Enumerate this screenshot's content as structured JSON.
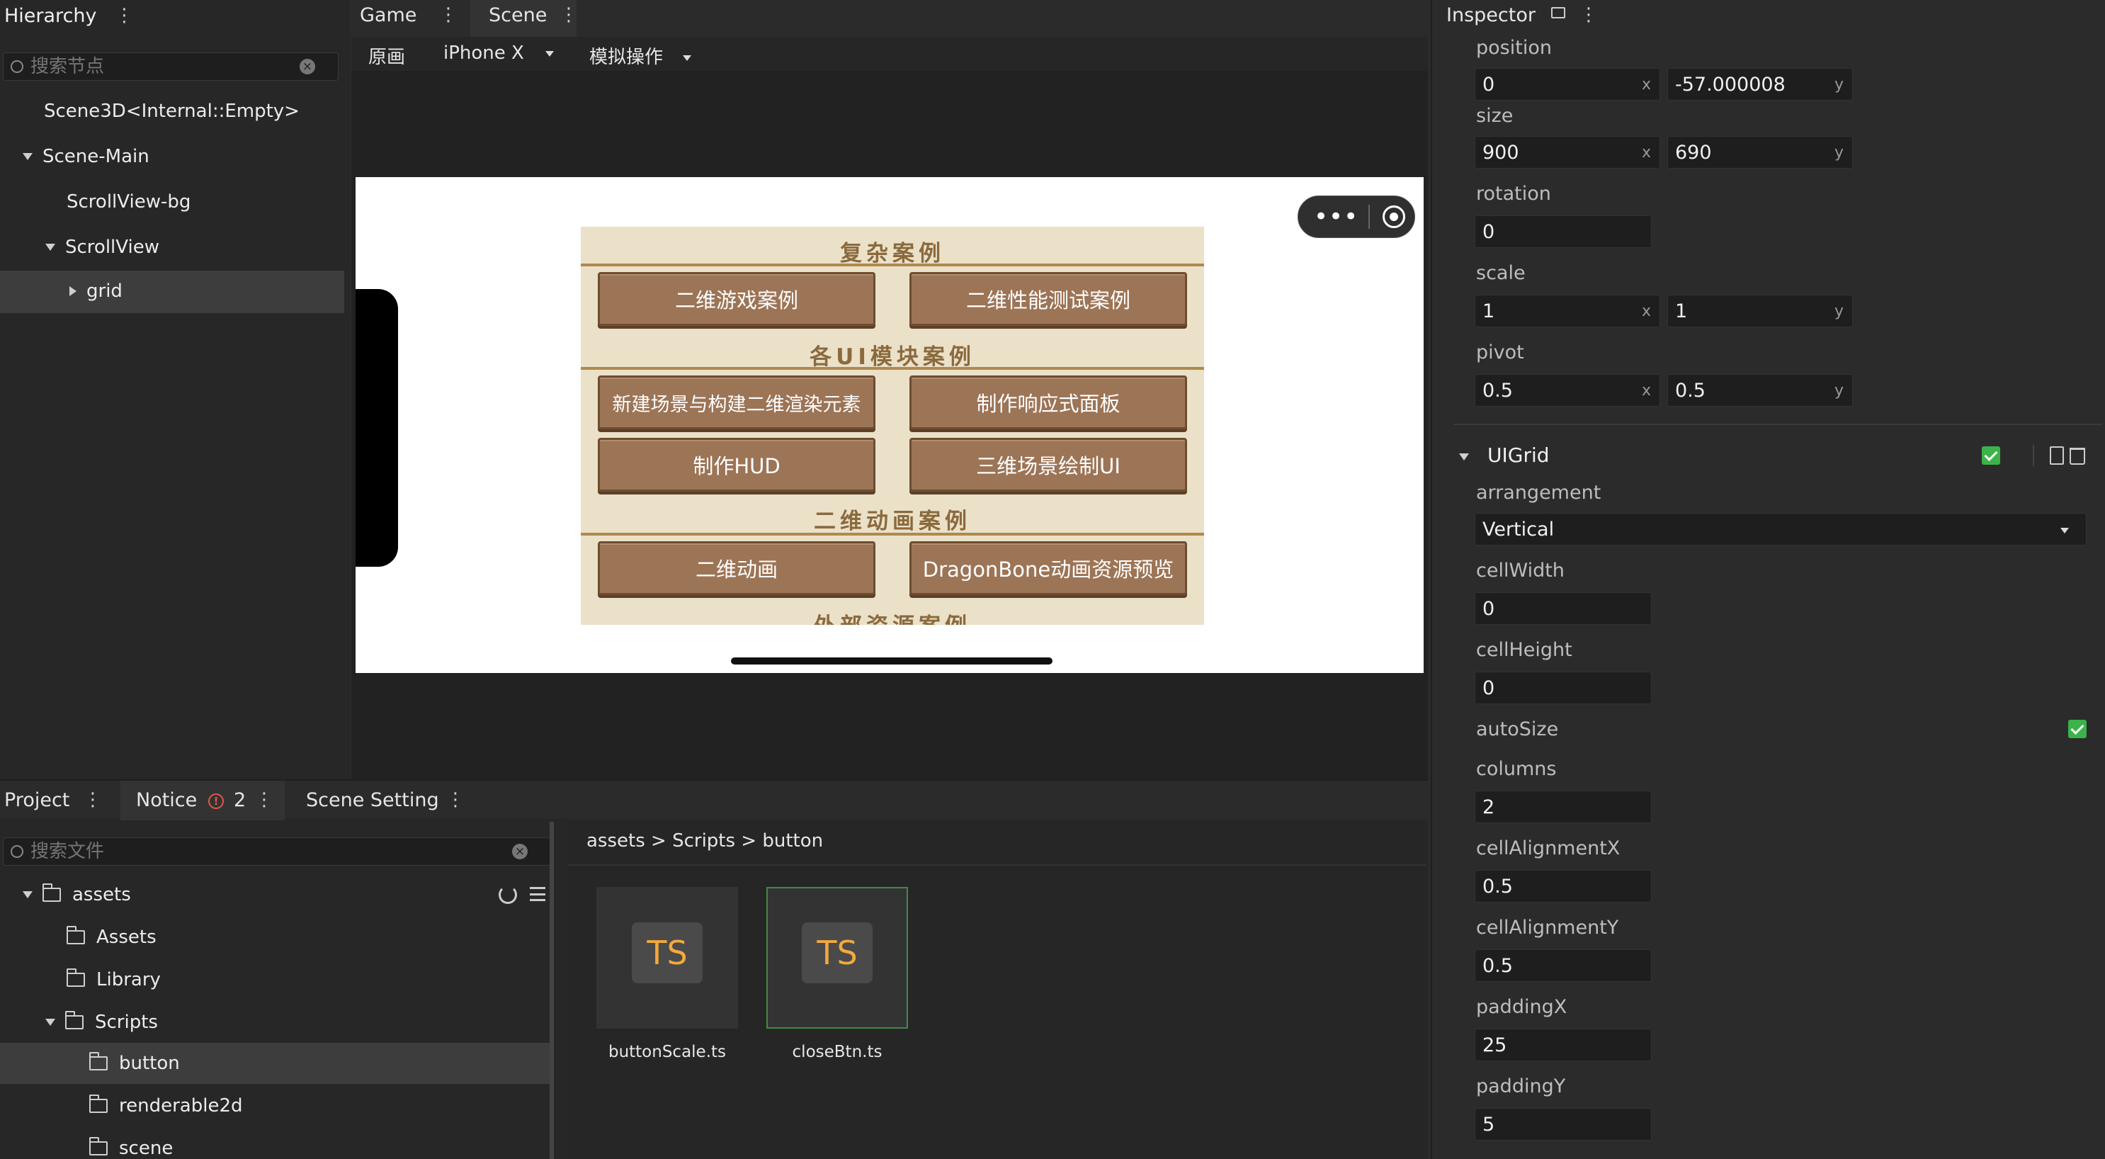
{
  "hierarchy": {
    "title": "Hierarchy",
    "search_placeholder": "搜索节点",
    "nodes": [
      "Scene3D<Internal::Empty>",
      "Scene-Main",
      "ScrollView-bg",
      "ScrollView",
      "grid"
    ]
  },
  "center": {
    "tabs": [
      "Game",
      "Scene"
    ],
    "toolbar": {
      "mode": "原画",
      "device": "iPhone X",
      "simulate": "模拟操作"
    }
  },
  "game": {
    "sections": [
      "复杂案例",
      "各UI模块案例",
      "二维动画案例",
      "外部资源案例"
    ],
    "buttons": [
      "二维游戏案例",
      "二维性能测试案例",
      "新建场景与构建二维渲染元素",
      "制作响应式面板",
      "制作HUD",
      "三维场景绘制UI",
      "二维动画",
      "DragonBone动画资源预览"
    ]
  },
  "inspector": {
    "title": "Inspector",
    "position": {
      "label": "position",
      "x": "0",
      "y": "-57.000008"
    },
    "size": {
      "label": "size",
      "x": "900",
      "y": "690"
    },
    "rotation": {
      "label": "rotation",
      "value": "0"
    },
    "scale": {
      "label": "scale",
      "x": "1",
      "y": "1"
    },
    "pivot": {
      "label": "pivot",
      "x": "0.5",
      "y": "0.5"
    },
    "axis_x": "x",
    "axis_y": "y",
    "component": "UIGrid",
    "arrangement": {
      "label": "arrangement",
      "value": "Vertical"
    },
    "cellWidth": {
      "label": "cellWidth",
      "value": "0"
    },
    "cellHeight": {
      "label": "cellHeight",
      "value": "0"
    },
    "autoSize": {
      "label": "autoSize"
    },
    "columns": {
      "label": "columns",
      "value": "2"
    },
    "cellAlignmentX": {
      "label": "cellAlignmentX",
      "value": "0.5"
    },
    "cellAlignmentY": {
      "label": "cellAlignmentY",
      "value": "0.5"
    },
    "paddingX": {
      "label": "paddingX",
      "value": "25"
    },
    "paddingY": {
      "label": "paddingY",
      "value": "5"
    }
  },
  "project": {
    "tabs": {
      "project": "Project",
      "notice": "Notice",
      "notice_count": "2",
      "scene_setting": "Scene Setting"
    },
    "search_placeholder": "搜索文件",
    "tree": [
      "assets",
      "Assets",
      "Library",
      "Scripts",
      "button",
      "renderable2d",
      "scene"
    ],
    "breadcrumb": "assets > Scripts > button",
    "files": [
      {
        "badge": "TS",
        "name": "buttonScale.ts"
      },
      {
        "badge": "TS",
        "name": "closeBtn.ts"
      }
    ]
  }
}
